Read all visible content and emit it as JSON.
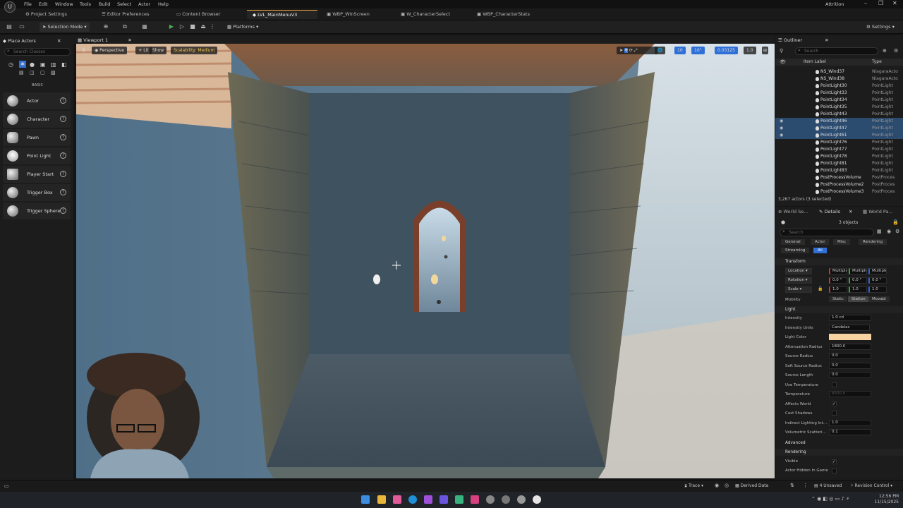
{
  "menubar": {
    "items": [
      "File",
      "Edit",
      "Window",
      "Tools",
      "Build",
      "Select",
      "Actor",
      "Help"
    ],
    "project": "Attrition"
  },
  "tabs": {
    "project_settings": "Project Settings",
    "editor_prefs": "Editor Preferences",
    "content_browser": "Content Browser",
    "level": "LVL_MainMenuV3",
    "win_screen": "WBP_WinScreen",
    "char_select": "W_CharacterSelect",
    "char_stats": "WBP_CharacterStats"
  },
  "toolbar": {
    "selection_mode": "Selection Mode",
    "platforms": "Platforms",
    "settings": "Settings"
  },
  "place_actors": {
    "tab": "Place Actors",
    "search_placeholder": "Search Classes",
    "category": "BASIC",
    "items": [
      "Actor",
      "Character",
      "Pawn",
      "Point Light",
      "Player Start",
      "Trigger Box",
      "Trigger Sphere"
    ]
  },
  "viewport": {
    "tab": "Viewport 1",
    "perspective": "Perspective",
    "lit": "Lit",
    "show": "Show",
    "scalability": "Scalability: Medium",
    "snap_grid": "10",
    "snap_angle": "10°",
    "snap_scale": "0.03125",
    "camera_speed": "1.0"
  },
  "outliner": {
    "tab": "Outliner",
    "search_placeholder": "Search",
    "col_label": "Item Label",
    "col_type": "Type",
    "rows": [
      {
        "name": "NS_Wind37",
        "type": "NiagaraActo",
        "sel": false
      },
      {
        "name": "NS_Wind38",
        "type": "NiagaraActo",
        "sel": false
      },
      {
        "name": "PointLight30",
        "type": "PointLight",
        "sel": false
      },
      {
        "name": "PointLight33",
        "type": "PointLight",
        "sel": false
      },
      {
        "name": "PointLight34",
        "type": "PointLight",
        "sel": false
      },
      {
        "name": "PointLight35",
        "type": "PointLight",
        "sel": false
      },
      {
        "name": "PointLight43",
        "type": "PointLight",
        "sel": false
      },
      {
        "name": "PointLight46",
        "type": "PointLight",
        "sel": true
      },
      {
        "name": "PointLight47",
        "type": "PointLight",
        "sel": true
      },
      {
        "name": "PointLight61",
        "type": "PointLight",
        "sel": true
      },
      {
        "name": "PointLight76",
        "type": "PointLight",
        "sel": false
      },
      {
        "name": "PointLight77",
        "type": "PointLight",
        "sel": false
      },
      {
        "name": "PointLight78",
        "type": "PointLight",
        "sel": false
      },
      {
        "name": "PointLight81",
        "type": "PointLight",
        "sel": false
      },
      {
        "name": "PointLight83",
        "type": "PointLight",
        "sel": false
      },
      {
        "name": "PostProcessVolume",
        "type": "PostProces",
        "sel": false
      },
      {
        "name": "PostProcessVolume2",
        "type": "PostProces",
        "sel": false
      },
      {
        "name": "PostProcessVolume3",
        "type": "PostProces",
        "sel": false
      }
    ],
    "footer": "3,267 actors (3 selected)"
  },
  "details": {
    "tab_world": "World Se...",
    "tab_details": "Details",
    "tab_world_partition": "World Pa...",
    "objects": "3 objects",
    "search_placeholder": "Search",
    "filters": [
      "General",
      "Actor",
      "Misc",
      "Rendering",
      "Streaming",
      "All"
    ],
    "sec_transform": "Transform",
    "location": "Location",
    "rotation": "Rotation",
    "scale": "Scale",
    "multiple": "Multiple",
    "rot_val": "0.0 °",
    "scale_val": "1.0",
    "mobility": "Mobility",
    "mob_opts": [
      "Static",
      "Station",
      "Movabl"
    ],
    "sec_light": "Light",
    "props": [
      {
        "label": "Intensity",
        "value": "1.0 cd"
      },
      {
        "label": "Intensity Units",
        "value": "Candelas"
      },
      {
        "label": "Light Color",
        "value": ""
      },
      {
        "label": "Attenuation Radius",
        "value": "1800.0"
      },
      {
        "label": "Source Radius",
        "value": "0.0"
      },
      {
        "label": "Soft Source Radius",
        "value": "0.0"
      },
      {
        "label": "Source Length",
        "value": "0.0"
      },
      {
        "label": "Use Temperature",
        "value": ""
      },
      {
        "label": "Temperature",
        "value": "6500.0"
      },
      {
        "label": "Affects World",
        "value": "✓"
      },
      {
        "label": "Cast Shadows",
        "value": ""
      },
      {
        "label": "Indirect Lighting Int...",
        "value": "1.0"
      },
      {
        "label": "Volumetric Scatteri...",
        "value": "0.1"
      }
    ],
    "advanced": "Advanced",
    "sec_rendering": "Rendering",
    "visible": "Visible",
    "hidden_in_game": "Actor Hidden In Game",
    "light_color_hex": "#f6d2a0"
  },
  "statusbar": {
    "trace": "Trace",
    "derived_data": "Derived Data",
    "unsaved": "4 Unsaved",
    "revision": "Revision Control"
  },
  "taskbar": {
    "time": "12:56 PM",
    "date": "11/15/2025"
  }
}
